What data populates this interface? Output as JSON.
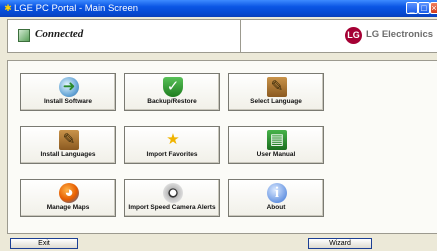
{
  "window": {
    "title": "LGE PC Portal - Main Screen",
    "controls": {
      "minimize": "_",
      "maximize": "□",
      "close": "×"
    }
  },
  "header": {
    "status": "Connected",
    "brand_mark": "LG",
    "brand_name": "LG Electronics"
  },
  "tiles": [
    {
      "label": "Install Software",
      "icon": "cd-install-icon",
      "glyph": "➜"
    },
    {
      "label": "Backup/Restore",
      "icon": "shield-icon",
      "glyph": "✓"
    },
    {
      "label": "Select Language",
      "icon": "box-icon",
      "glyph": "✎"
    },
    {
      "label": "Install Languages",
      "icon": "box-icon",
      "glyph": "✎"
    },
    {
      "label": "Import Favorites",
      "icon": "star-icon",
      "glyph": "★"
    },
    {
      "label": "User Manual",
      "icon": "book-icon",
      "glyph": "▤"
    },
    {
      "label": "Manage Maps",
      "icon": "globe-icon",
      "glyph": "◕"
    },
    {
      "label": "Import Speed Camera Alerts",
      "icon": "camera-icon",
      "glyph": "●"
    },
    {
      "label": "About",
      "icon": "info-icon",
      "glyph": "i"
    }
  ],
  "footer": {
    "exit_label": "Exit",
    "wizard_label": "Wizard"
  },
  "colors": {
    "titlebar": "#0a55e4",
    "brand": "#a50034",
    "window_bg": "#ece9d8"
  }
}
